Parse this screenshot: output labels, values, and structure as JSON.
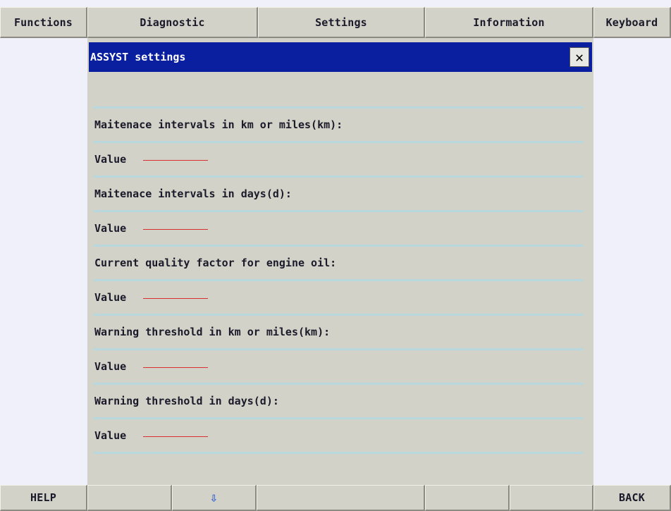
{
  "menu": {
    "functions": "Functions",
    "diagnostic": "Diagnostic",
    "settings": "Settings",
    "information": "Information",
    "keyboard": "Keyboard"
  },
  "dialog": {
    "title": "ASSYST settings",
    "close_symbol": "✕",
    "rows": [
      {
        "label": "Maitenace intervals in km or miles(km):"
      },
      {
        "value_label": "Value"
      },
      {
        "label": "Maitenace intervals in days(d):"
      },
      {
        "value_label": "Value"
      },
      {
        "label": "Current quality factor for engine oil:"
      },
      {
        "value_label": "Value"
      },
      {
        "label": "Warning threshold in km or miles(km):"
      },
      {
        "value_label": "Value"
      },
      {
        "label": "Warning threshold in days(d):"
      },
      {
        "value_label": "Value"
      }
    ]
  },
  "footer": {
    "help": "HELP",
    "down_arrow": "⇩",
    "back": "BACK"
  },
  "colors": {
    "titlebar": "#0a1ea0",
    "background": "#d3d2c8",
    "side_panel": "#f0f0fa",
    "separator": "#b8d8de",
    "value_line": "#d83030"
  }
}
